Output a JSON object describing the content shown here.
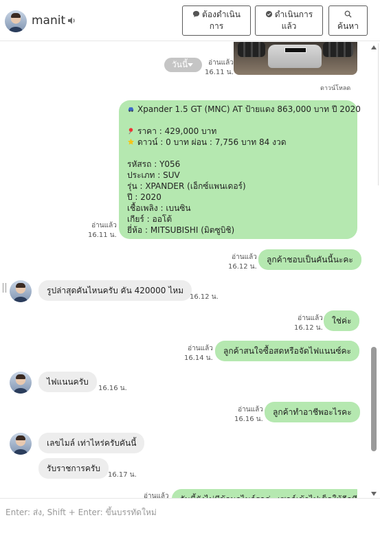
{
  "header": {
    "contact_name": "manit",
    "buttons": {
      "pending_line1": "ต้องดำเนิน",
      "pending_line2": "การ",
      "done_line1": "ดำเนินการ",
      "done_line2": "แล้ว",
      "search": "ค้นหา"
    }
  },
  "image_message": {
    "day_chip": "วันนี้",
    "read": "อ่านแล้ว",
    "time": "16.11 น.",
    "download": "ดาวน์โหลด"
  },
  "listing": {
    "title": "Xpander 1.5 GT (MNC) AT ป้ายแดง 863,000 บาท ปี 2020",
    "price": "ราคา : 429,000 บาท",
    "down": "ดาวน์ : 0 บาท ผ่อน : 7,756 บาท 84 งวด",
    "code": "รหัสรถ : Y056",
    "type": "ประเภท : SUV",
    "model": "รุ่น : XPANDER (เอ็กซ์แพนเดอร์)",
    "year": "ปี : 2020",
    "fuel": "เชื้อเพลิง : เบนซิน",
    "gear": "เกียร์ : ออโต้",
    "brand": "ยี่ห้อ : MITSUBISHI (มิตซูบิชิ)",
    "read": "อ่านแล้ว",
    "time": "16.11 น."
  },
  "messages": {
    "m1": {
      "text": "ลูกค้าชอบเป็นคันนี้นะคะ",
      "read": "อ่านแล้ว",
      "time": "16.12 น."
    },
    "m2": {
      "text": "รูปล่าสุดคันไหนครับ คัน 420000 ไหม",
      "time": "16.12 น."
    },
    "m3": {
      "text": "ใช่ค่ะ",
      "read": "อ่านแล้ว",
      "time": "16.12 น."
    },
    "m4": {
      "text": "ลูกค้าสนใจซื้อสดหรือจัดไฟแนนซ์คะ",
      "read": "อ่านแล้ว",
      "time": "16.14 น."
    },
    "m5": {
      "text": "ไฟแนนครับ",
      "time": "16.16 น."
    },
    "m6": {
      "text": "ลูกค้าทำอาชีพอะไรคะ",
      "read": "อ่านแล้ว",
      "time": "16.16 น."
    },
    "m7": {
      "text": "เลขไมล์ เท่าไหร่ครับคันนี้"
    },
    "m8": {
      "text": "รับราชการครับ",
      "time": "16.17 น."
    },
    "m9": {
      "text": "วันนี้ยังไม่มีข้อมูลไมล์รถค่ะ เซลล์เข้าไปเช็คให้อีกที",
      "read": "อ่านแล้ว"
    }
  },
  "composer": {
    "placeholder": "Enter: ส่ง, Shift + Enter: ขึ้นบรรทัดใหม่"
  },
  "colors": {
    "outgoing_bubble": "#b5e8b0",
    "incoming_bubble": "#ededed"
  }
}
